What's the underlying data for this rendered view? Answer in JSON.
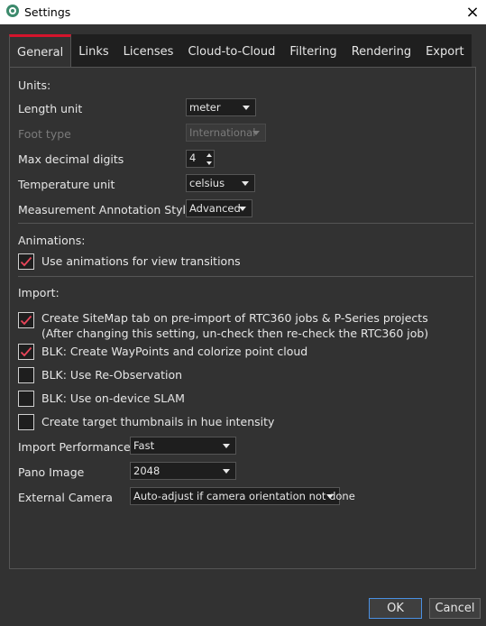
{
  "window": {
    "title": "Settings",
    "close_icon": "×"
  },
  "tabs": [
    {
      "label": "General",
      "active": true
    },
    {
      "label": "Links"
    },
    {
      "label": "Licenses"
    },
    {
      "label": "Cloud-to-Cloud"
    },
    {
      "label": "Filtering"
    },
    {
      "label": "Rendering"
    },
    {
      "label": "Export"
    }
  ],
  "units": {
    "section_label": "Units:",
    "length_unit": {
      "label": "Length unit",
      "value": "meter"
    },
    "foot_type": {
      "label": "Foot type",
      "value": "International",
      "disabled": true
    },
    "max_decimal_digits": {
      "label": "Max decimal digits",
      "value": "4"
    },
    "temperature_unit": {
      "label": "Temperature unit",
      "value": "celsius"
    },
    "annotation_style": {
      "label": "Measurement Annotation Style",
      "value": "Advanced"
    }
  },
  "animations": {
    "section_label": "Animations:",
    "use_animations": {
      "label": "Use animations for view transitions",
      "checked": true
    }
  },
  "import": {
    "section_label": "Import:",
    "sitemap": {
      "line1": "Create SiteMap tab on pre-import of RTC360 jobs & P-Series projects",
      "line2": "(After changing this setting, un-check then re-check the RTC360 job)",
      "checked": true
    },
    "waypoints": {
      "label": "BLK: Create WayPoints and colorize point cloud",
      "checked": true
    },
    "reobservation": {
      "label": "BLK: Use Re-Observation",
      "checked": false
    },
    "slam": {
      "label": "BLK: Use on-device SLAM",
      "checked": false
    },
    "thumbnails": {
      "label": "Create target thumbnails in hue intensity",
      "checked": false
    },
    "performance": {
      "label": "Import Performance",
      "value": "Fast"
    },
    "pano_image": {
      "label": "Pano Image",
      "value": "2048"
    },
    "external_camera": {
      "label": "External Camera",
      "value": "Auto-adjust if camera orientation not done"
    }
  },
  "buttons": {
    "ok": "OK",
    "cancel": "Cancel"
  },
  "colors": {
    "accent_tab": "#d4142c",
    "checkmark": "#e8455a",
    "focus_border": "#4a90e2"
  }
}
